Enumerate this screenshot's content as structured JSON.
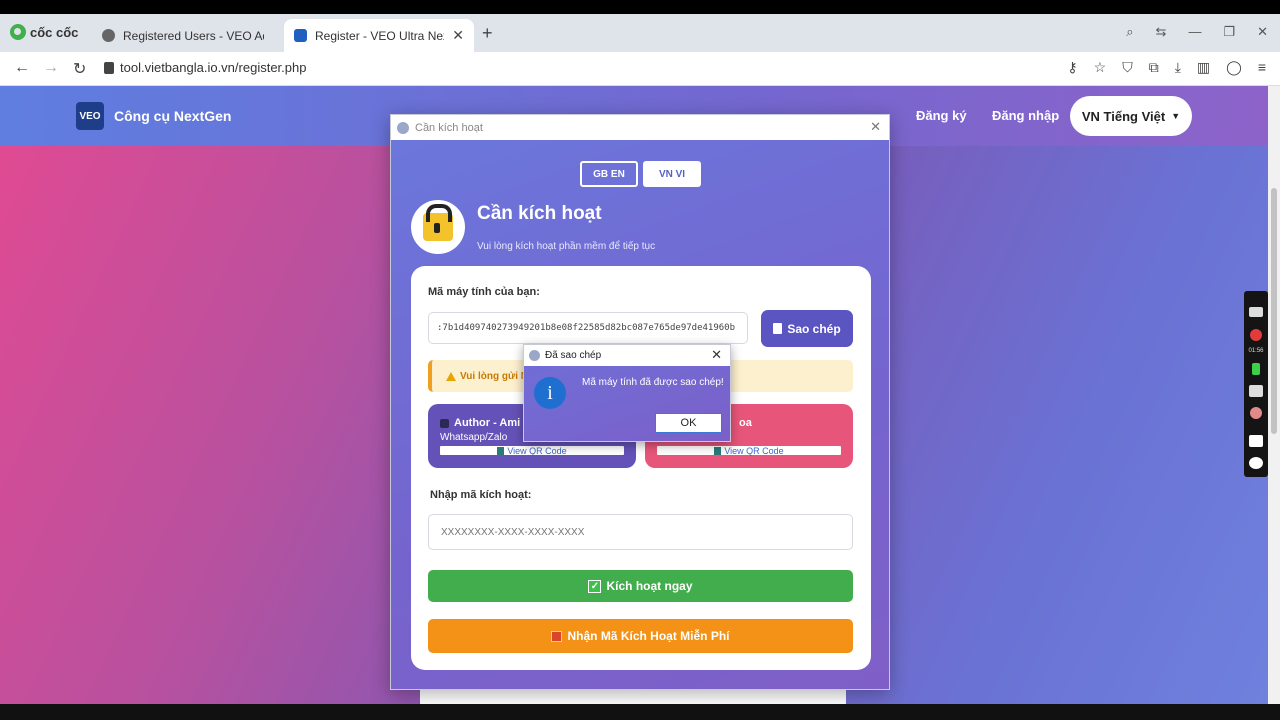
{
  "browser": {
    "brand": "cốc cốc",
    "tabs": [
      {
        "title": "Registered Users - VEO Admin",
        "active": false
      },
      {
        "title": "Register - VEO Ultra NextGe",
        "active": true
      }
    ],
    "url": "tool.vietbangla.io.vn/register.php"
  },
  "site": {
    "logo_text": "VEO",
    "title": "Công cụ NextGen",
    "nav": {
      "register": "Đăng ký",
      "login": "Đăng nhập"
    },
    "language_button": "VN Tiếng Việt",
    "language_caret": "▼"
  },
  "activation_window": {
    "title": "Cần kích hoạt",
    "lang_en": "GB EN",
    "lang_vi": "VN VI",
    "heading": "Cần kích hoạt",
    "subheading": "Vui lòng kích hoạt phần mềm để tiếp tục",
    "machine_label": "Mã máy tính của bạn:",
    "machine_id": ":7b1d409740273949201b8e08f22585d82bc087e765de97de41960b",
    "copy_button": "Sao chép",
    "warning_text": "Vui lòng gửi Mã",
    "contacts": [
      {
        "name": "Author - Ami",
        "sub": "Whatsapp/Zalo",
        "qr": "View QR Code",
        "color": "#6552b8"
      },
      {
        "name": "oa",
        "qr": "View QR Code",
        "color": "#e8557a"
      }
    ],
    "code_label": "Nhập mã kích hoạt:",
    "code_placeholder": "XXXXXXXX-XXXX-XXXX-XXXX",
    "activate_button": "Kích hoạt ngay",
    "activate_check": "✓",
    "free_button": "Nhận Mã Kích Hoạt Miễn Phí"
  },
  "dialog": {
    "title": "Đã sao chép",
    "message": "Mã máy tính đã được sao chép!",
    "icon": "i",
    "ok": "OK"
  },
  "recorder": {
    "time": "01:56"
  },
  "colors": {
    "accent": "#5b55c2",
    "success": "#42ad4c",
    "warning": "#f39217",
    "info": "#1f6fd1"
  }
}
